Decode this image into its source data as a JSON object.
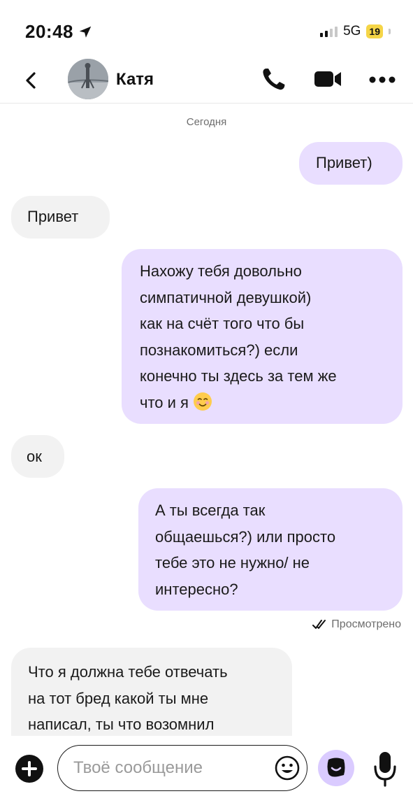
{
  "status_bar": {
    "time": "20:48",
    "network": "5G",
    "battery": "19"
  },
  "header": {
    "contact_name": "Катя",
    "icons": [
      "back-arrow-icon",
      "phone-icon",
      "video-camera-icon",
      "more-dots-icon"
    ]
  },
  "chat": {
    "date_separator": "Сегодня",
    "messages": [
      {
        "direction": "outgoing",
        "lines": [
          "Привет)"
        ]
      },
      {
        "direction": "incoming",
        "lines": [
          "Привет"
        ]
      },
      {
        "direction": "outgoing",
        "lines": [
          "Нахожу тебя довольно",
          "симпатичной девушкой)",
          "как на счёт того что бы",
          "познакомиться?) если",
          "конечно ты здесь за тем же",
          "что и я"
        ],
        "trailing_emoji": "smiling-face-icon"
      },
      {
        "direction": "incoming",
        "lines": [
          "ок"
        ]
      },
      {
        "direction": "outgoing",
        "lines": [
          "А ты всегда так",
          "общаешься?) или просто",
          "тебе это не нужно/ не",
          "интересно?"
        ]
      },
      {
        "direction": "incoming",
        "lines": [
          "Что я должна тебе отвечать",
          "на тот бред какой ты мне",
          "написал, ты что возомнил"
        ]
      }
    ],
    "read_status": "Просмотрено"
  },
  "composer": {
    "placeholder": "Твоё сообщение",
    "value": ""
  },
  "colors": {
    "outgoing_bubble": "#e9deff",
    "incoming_bubble": "#f2f2f2",
    "battery": "#f5d547",
    "sticker_button": "#dacbff"
  }
}
